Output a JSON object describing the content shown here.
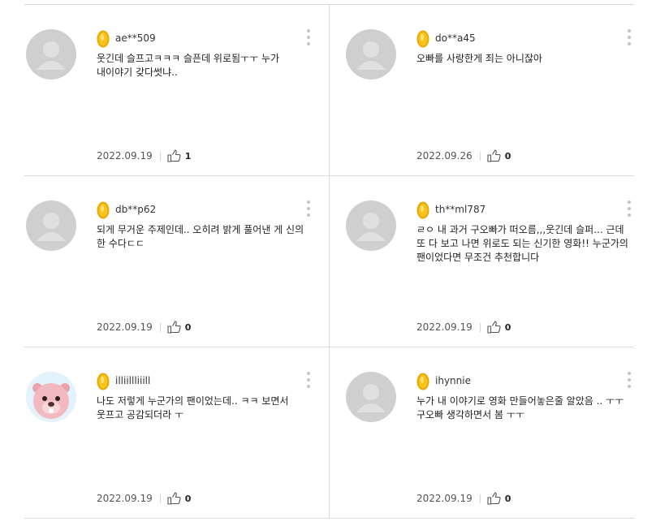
{
  "comments": [
    {
      "nick": "ae**509",
      "text": "웃긴데 슬프고ㅋㅋㅋ 슬픈데 위로됨ㅜㅜ 누가 내이야기 갖다썻냐..",
      "date": "2022.09.19",
      "likes": "1",
      "avatar": "default"
    },
    {
      "nick": "do**a45",
      "text": "오빠를 사랑한게 죄는 아니잖아",
      "date": "2022.09.26",
      "likes": "0",
      "avatar": "default"
    },
    {
      "nick": "db**p62",
      "text": "되게 무거운 주제인데.. 오히려 밝게 풀어낸 게 신의 한 수다ㄷㄷ",
      "date": "2022.09.19",
      "likes": "0",
      "avatar": "default"
    },
    {
      "nick": "th**ml787",
      "text": "ㄹㅇ 내 과거 구오빠가 떠오름,,,웃긴데 슬퍼... 근데 또 다 보고 나면 위로도 되는 신기한 영화!! 누군가의 팬이었다면 무조건 추천합니다",
      "date": "2022.09.19",
      "likes": "0",
      "avatar": "default"
    },
    {
      "nick": "illiillliiill",
      "text": "나도 저렇게 누군가의 팬이었는데.. ㅋㅋ 보면서 웃프고 공감되더라 ㅜ",
      "date": "2022.09.19",
      "likes": "0",
      "avatar": "beaver-character"
    },
    {
      "nick": "ihynnie",
      "text": "누가 내 이야기로 영화 만들어놓은줄 알았음 .. ㅜㅜ 구오빠 생각하면서 봄 ㅜㅜ",
      "date": "2022.09.19",
      "likes": "0",
      "avatar": "default"
    }
  ],
  "icons": {
    "badge": "gold-coin-badge-icon",
    "more": "more-vertical-icon",
    "like": "thumbs-up-icon"
  },
  "colors": {
    "badge": "#f2b705",
    "avatar_bg": "#cfcfcf",
    "divider": "#dcdcdc"
  }
}
